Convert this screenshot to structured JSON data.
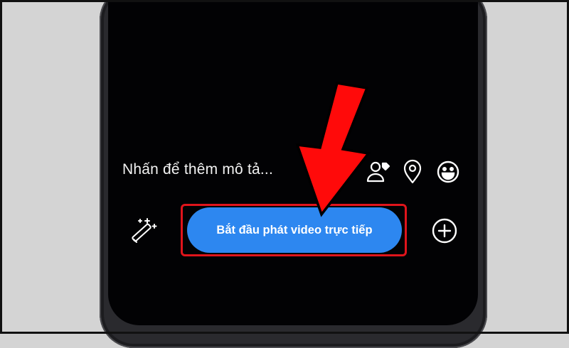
{
  "composer": {
    "caption_placeholder": "Nhấn để thêm mô tả...",
    "live_button_label": "Bắt đầu phát video trực tiếp"
  },
  "icons": {
    "tag_people": "tag-people-icon",
    "location": "location-pin-icon",
    "emoji": "smiley-icon",
    "effects": "magic-wand-icon",
    "add": "plus-circle-icon"
  },
  "colors": {
    "live_button": "#2d87f0",
    "highlight": "#e0141b",
    "annotation_arrow": "#ff0a0a",
    "screen_background": "#020204"
  }
}
